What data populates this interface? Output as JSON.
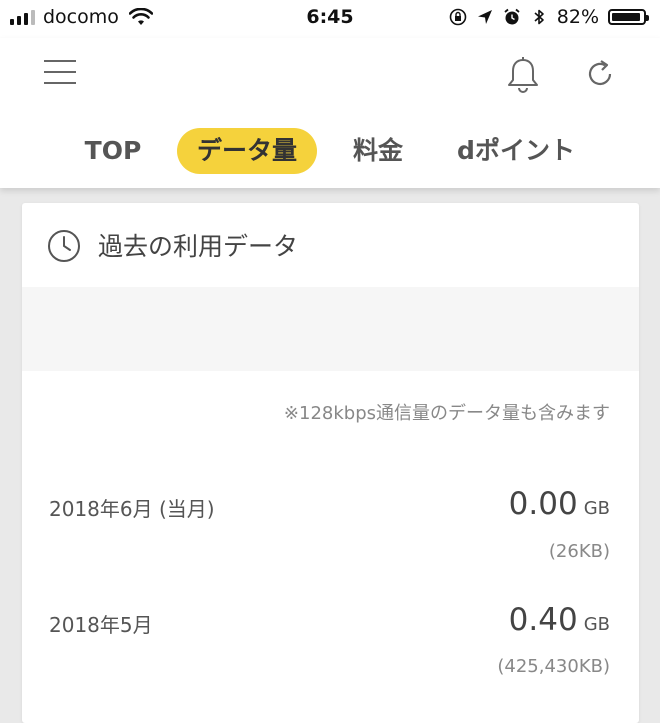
{
  "statusbar": {
    "carrier": "docomo",
    "time": "6:45",
    "battery": "82%",
    "battery_level": 0.82
  },
  "header": {
    "tabs": [
      {
        "label": "TOP",
        "active": false
      },
      {
        "label": "データ量",
        "active": true
      },
      {
        "label": "料金",
        "active": false
      },
      {
        "label": "dポイント",
        "active": false
      }
    ]
  },
  "card": {
    "title": "過去の利用データ",
    "note": "※128kbps通信量のデータ量も含みます",
    "rows": [
      {
        "month": "2018年6月 (当月)",
        "value": "0.00",
        "unit": "GB",
        "sub": "(26KB)"
      },
      {
        "month": "2018年5月",
        "value": "0.40",
        "unit": "GB",
        "sub": "(425,430KB)"
      }
    ]
  },
  "colors": {
    "accent": "#f5d23c",
    "background": "#e9e9e9"
  },
  "icons": [
    "signal-icon",
    "wifi-icon",
    "orientation-lock-icon",
    "location-icon",
    "alarm-icon",
    "bluetooth-icon",
    "battery-icon",
    "menu-icon",
    "bell-icon",
    "refresh-icon",
    "clock-icon"
  ]
}
